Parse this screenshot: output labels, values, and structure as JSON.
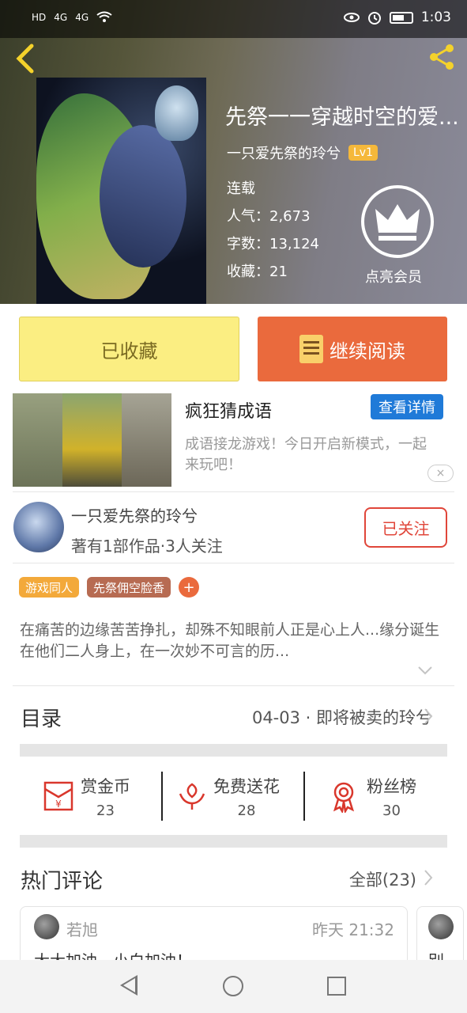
{
  "status_bar": {
    "left_icons": [
      "HD",
      "4G",
      "4G",
      "wifi-icon"
    ],
    "time": "1:03"
  },
  "book": {
    "title": "先祭一一穿越时空的爱...",
    "author": "一只爱先祭的玲兮",
    "level": "Lv1",
    "status": "连载",
    "popularity": "人气：2,673",
    "word_count": "字数：13,124",
    "favorites": "收藏：21",
    "vip_label": "点亮会员"
  },
  "actions": {
    "favorited_label": "已收藏",
    "continue_label": "继续阅读"
  },
  "ad": {
    "title": "疯狂猜成语",
    "detail_button": "查看详情",
    "description": "成语接龙游戏！今日开启新模式，一起来玩吧！",
    "close_symbol": "×"
  },
  "uploader": {
    "name": "一只爱先祭的玲兮",
    "stats": "著有1部作品·3人关注",
    "follow_label": "已关注"
  },
  "tags": [
    "游戏同人",
    "先祭佣空脸香"
  ],
  "tag_add_symbol": "+",
  "intro": "在痛苦的边缘苦苦挣扎，却殊不知眼前人正是心上人...缘分诞生在他们二人身上，在一次妙不可言的历...",
  "toc": {
    "label": "目录",
    "latest_chapter": "04-03 · 即将被卖的玲兮"
  },
  "stats": [
    {
      "label": "赏金币",
      "value": "23",
      "icon": "red-envelope-icon"
    },
    {
      "label": "免费送花",
      "value": "28",
      "icon": "flower-icon"
    },
    {
      "label": "粉丝榜",
      "value": "30",
      "icon": "medal-icon"
    }
  ],
  "comments": {
    "section_label": "热门评论",
    "all_label": "全部(23)",
    "items": [
      {
        "user": "若旭",
        "time": "昨天 21:32",
        "text": "大大加油，小白加油！"
      }
    ],
    "second_preview_text": "别"
  },
  "colors": {
    "accent_orange": "#ea6a3d",
    "fav_yellow": "#fbee82",
    "follow_red": "#e0463a",
    "detail_blue": "#1f7ad8",
    "back_icon": "#f4d22b"
  }
}
